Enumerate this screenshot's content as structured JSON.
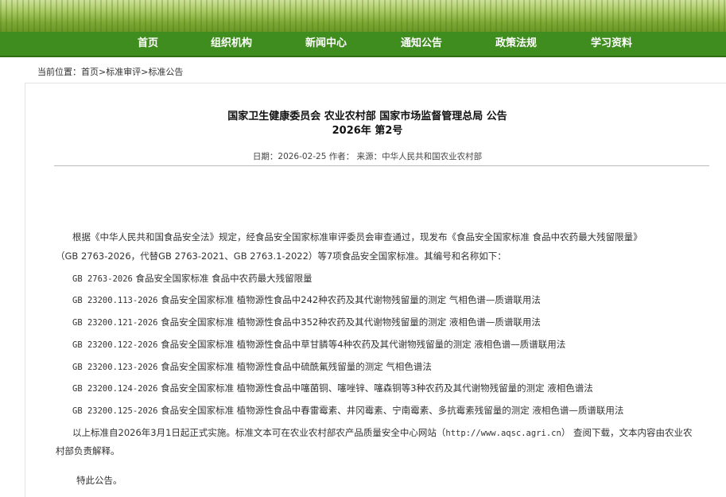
{
  "nav": {
    "items": [
      "首页",
      "组织机构",
      "新闻中心",
      "通知公告",
      "政策法规",
      "学习资料"
    ]
  },
  "breadcrumb": {
    "prefix": "当前位置：",
    "home": "首页",
    "sep1": ">",
    "level2": "标准审评",
    "sep2": ">",
    "level3": "标准公告"
  },
  "article": {
    "title_line1": "国家卫生健康委员会 农业农村部 国家市场监督管理总局 公告",
    "title_line2": "2026年 第2号",
    "meta": "日期：2026-02-25 作者： 来源：中华人民共和国农业农村部",
    "intro_line1": "根据《中华人民共和国食品安全法》规定，经食品安全国家标准审评委员会审查通过，现发布《食品安全国家标准 食品中农药最大残留限量》",
    "intro_line2": "（GB  2763-2026，代替GB  2763-2021、GB  2763.1-2022）等7项食品安全国家标准。其编号和名称如下：",
    "standards": [
      {
        "code": "GB 2763-2026",
        "name": "食品安全国家标准 食品中农药最大残留限量"
      },
      {
        "code": "GB 23200.113-2026",
        "name": "食品安全国家标准 植物源性食品中242种农药及其代谢物残留量的测定 气相色谱—质谱联用法"
      },
      {
        "code": "GB 23200.121-2026",
        "name": "食品安全国家标准 植物源性食品中352种农药及其代谢物残留量的测定 液相色谱—质谱联用法"
      },
      {
        "code": "GB 23200.122-2026",
        "name": "食品安全国家标准 植物源性食品中草甘膦等4种农药及其代谢物残留量的测定 液相色谱—质谱联用法"
      },
      {
        "code": "GB 23200.123-2026",
        "name": "食品安全国家标准 植物源性食品中硫酰氟残留量的测定 气相色谱法"
      },
      {
        "code": "GB 23200.124-2026",
        "name": "食品安全国家标准 植物源性食品中噻菌铜、噻唑锌、噻森铜等3种农药及其代谢物残留量的测定 液相色谱法"
      },
      {
        "code": "GB 23200.125-2026",
        "name": "食品安全国家标准 植物源性食品中春雷霉素、井冈霉素、宁南霉素、多抗霉素残留量的测定 液相色谱—质谱联用法"
      }
    ],
    "closing_line1_a": "以上标准自2026年3月1日起正式实施。标准文本可在农业农村部农产品质量安全中心网站（",
    "closing_url": "http://www.aqsc.agri.cn",
    "closing_line1_b": "）  查阅下载，文本内容由农业农",
    "closing_line2": "村部负责解释。",
    "sign_off": "特此公告。"
  }
}
